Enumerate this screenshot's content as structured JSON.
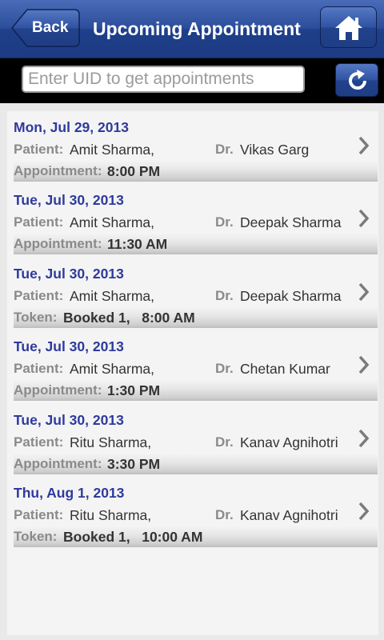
{
  "header": {
    "back_label": "Back",
    "title": "Upcoming Appointment",
    "home_icon": "home-icon"
  },
  "search": {
    "placeholder": "Enter UID to get appointments",
    "value": "",
    "refresh_icon": "refresh-icon"
  },
  "labels": {
    "patient": "Patient:",
    "doctor": "Dr.",
    "appointment": "Appointment:",
    "token": "Token:"
  },
  "appointments": [
    {
      "date": "Mon, Jul 29, 2013",
      "patient": "Amit Sharma,",
      "doctor": "Vikas Garg",
      "kind": "Appointment:",
      "detail": "8:00 PM"
    },
    {
      "date": "Tue, Jul 30, 2013",
      "patient": "Amit Sharma,",
      "doctor": "Deepak Sharma",
      "kind": "Appointment:",
      "detail": "11:30 AM"
    },
    {
      "date": "Tue, Jul 30, 2013",
      "patient": "Amit Sharma,",
      "doctor": "Deepak Sharma",
      "kind": "Token:",
      "detail": "Booked 1,   8:00 AM"
    },
    {
      "date": "Tue, Jul 30, 2013",
      "patient": "Amit Sharma,",
      "doctor": "Chetan Kumar",
      "kind": "Appointment:",
      "detail": "1:30 PM"
    },
    {
      "date": "Tue, Jul 30, 2013",
      "patient": "Ritu Sharma,",
      "doctor": "Kanav Agnihotri",
      "kind": "Appointment:",
      "detail": "3:30 PM"
    },
    {
      "date": "Thu, Aug 1, 2013",
      "patient": "Ritu Sharma,",
      "doctor": "Kanav Agnihotri",
      "kind": "Token:",
      "detail": "Booked 1,   10:00 AM"
    }
  ],
  "colors": {
    "header": "#2d4e9b",
    "date_text": "#2e3a9c",
    "label_text": "#8a8a8a"
  }
}
